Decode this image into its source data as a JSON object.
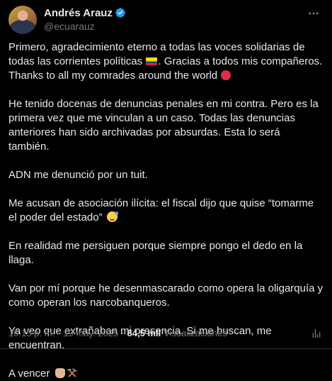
{
  "author": {
    "display_name": "Andrés Arauz",
    "handle": "@ecuarauz",
    "verified": true
  },
  "icons": {
    "verified": "verified-badge-icon",
    "more": "more-options-icon",
    "stats": "analytics-icon",
    "flag": "ecuador-flag-emoji",
    "red_circle": "red-circle-emoji",
    "sweat_smile": "grinning-face-with-sweat-emoji",
    "fist": "raised-fist-emoji",
    "tools": "hammer-and-pick-emoji"
  },
  "colors": {
    "background": "#000000",
    "text": "#e7e9ea",
    "secondary_text": "#71767b",
    "verified_blue": "#1d9bf0",
    "divider": "#2f3336"
  },
  "post": {
    "p1_a": "Primero, agradecimiento eterno a todas las voces solidarias de todas las corrientes políticas ",
    "p1_b": ". Gracias a todos mis compañeros. Thanks to all my comrades around the world ",
    "p2": "He tenido docenas de denuncias penales en mi contra. Pero es la primera vez que me vinculan a un caso. Todas las denuncias anteriores han sido archivadas por absurdas. Esta lo será también.",
    "p3": "ADN me denunció por un tuit.",
    "p4": "Me acusan de asociación ilícita: el fiscal dijo que quise “tomarme el poder del estado” ",
    "p5": "En realidad me persiguen porque siempre pongo el dedo en la llaga.",
    "p6": "Van por mí porque he desenmascarado como opera la oligarquía y como operan los narcobanqueros.",
    "p7": "Ya veo que extrañaban mi presencia. Si me buscan, me encuentran.",
    "p8": "A vencer "
  },
  "meta": {
    "time": "10:15 p. m.",
    "separator": "·",
    "date": "19 may. 2025",
    "views_count": "84,5 mil",
    "views_label": "Visualizaciones"
  }
}
